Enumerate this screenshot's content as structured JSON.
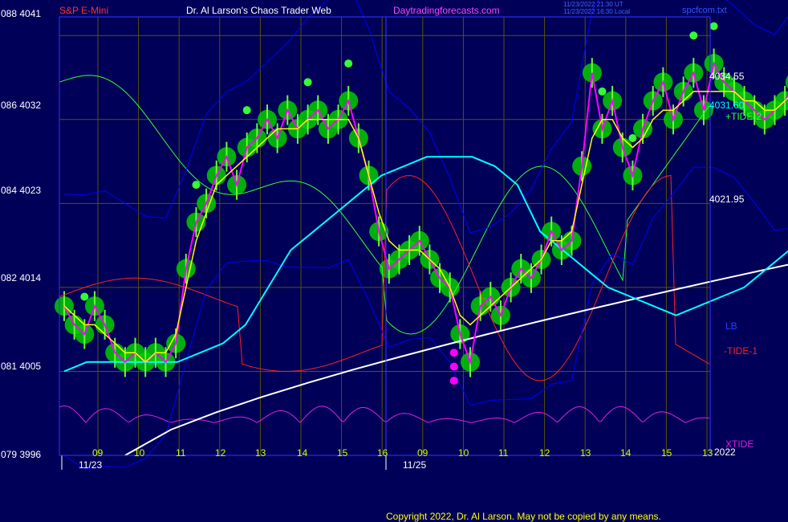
{
  "header": {
    "instrument": "S&P E-Mini",
    "title": "Dr. Al Larson's Chaos Trader Web",
    "site": "Daytradingforecasts.com",
    "timestamp_utc": "11/23/2022 21:30 UT",
    "timestamp_local": "11/23/2022 16:30 Local",
    "file": "spcfcom.txt"
  },
  "footer": {
    "copyright": "Copyright 2022, Dr. Al Larson. May not be copied by any means."
  },
  "colors": {
    "background": "#000058",
    "price": "#ff00ff",
    "price_smooth": "#ffff00",
    "price_avg": "#00ffff",
    "long_avg": "#ffffff",
    "bands": "#0000ff",
    "tide2": "#33ff33",
    "tide1": "#ff2020",
    "xtide": "#dd22dd",
    "glow": "#00cc00",
    "grid": "#555500"
  },
  "chart_data": {
    "type": "line",
    "left_axis_labels": [
      {
        "label": "088 4041",
        "value": 4041
      },
      {
        "label": "086 4032",
        "value": 4032
      },
      {
        "label": "084 4023",
        "value": 4023
      },
      {
        "label": "082 4014",
        "value": 4014
      },
      {
        "label": "081 4005",
        "value": 4005
      },
      {
        "label": "079 3996",
        "value": 3996
      }
    ],
    "right_labels": [
      {
        "text": "4034.55",
        "color": "#ffffff"
      },
      {
        "text": "4031.60",
        "color": "#00ffff"
      },
      {
        "text": "+TIDE-2",
        "color": "#33ff33"
      },
      {
        "text": "4021.95",
        "color": "#ffffff"
      },
      {
        "text": "LB",
        "color": "#0000ff"
      },
      {
        "text": "-TIDE-1",
        "color": "#ff2020"
      },
      {
        "text": "XTIDE",
        "color": "#dd22dd"
      },
      {
        "text": "2022",
        "color": "#ffffff"
      }
    ],
    "x_hours": [
      "09",
      "10",
      "11",
      "12",
      "13",
      "14",
      "15",
      "16",
      "09",
      "10",
      "11",
      "12",
      "13",
      "14",
      "15",
      "13"
    ],
    "x_dates": [
      "11/23",
      "11/25"
    ],
    "ylim": [
      3996,
      4043
    ],
    "price": {
      "x": [
        0,
        0.25,
        0.5,
        0.75,
        1,
        1.25,
        1.5,
        1.75,
        2,
        2.25,
        2.5,
        2.75,
        3,
        3.25,
        3.5,
        3.75,
        4,
        4.25,
        4.5,
        4.75,
        5,
        5.25,
        5.5,
        5.75,
        6,
        6.25,
        6.5,
        6.75,
        7,
        7.25,
        7.5,
        7.75,
        8,
        8.25,
        8.5,
        8.75,
        9,
        9.25,
        9.5,
        9.75,
        10,
        10.25,
        10.5,
        10.75,
        11,
        11.25,
        11.5,
        11.75,
        12,
        12.25,
        12.5,
        12.75,
        13,
        13.25,
        13.5,
        13.75,
        14,
        14.25,
        14.5,
        14.75,
        15,
        15.25,
        15.5,
        15.75,
        16,
        16.25,
        16.5,
        16.75,
        17,
        17.25,
        17.5,
        17.75,
        18,
        18.25,
        18.5,
        18.75,
        19,
        19.25,
        19.5,
        19.75,
        20,
        20.25,
        20.5,
        20.75,
        21,
        21.25,
        21.5,
        21.75,
        22,
        22.25,
        22.5,
        22.75,
        23,
        23.25,
        23.5,
        23.75,
        24
      ],
      "close": [
        4012,
        4010,
        4009,
        4012,
        4010,
        4007,
        4006,
        4007,
        4006,
        4007,
        4006,
        4008,
        4016,
        4021,
        4023,
        4026,
        4028,
        4025,
        4029,
        4030,
        4032,
        4030,
        4033,
        4031,
        4032,
        4033,
        4031,
        4032,
        4034,
        4030,
        4026,
        4020,
        4016,
        4017,
        4018,
        4019,
        4017,
        4015,
        4014,
        4009,
        4006,
        4012,
        4013,
        4011,
        4014,
        4016,
        4015,
        4017,
        4020,
        4018,
        4019,
        4027,
        4037,
        4031,
        4034,
        4029,
        4026,
        4031,
        4034,
        4036,
        4032,
        4035,
        4037,
        4033,
        4038,
        4036,
        4035,
        4034,
        4033,
        4032,
        4033,
        4034,
        4036,
        4035,
        4036,
        4035,
        4034,
        4033,
        4034,
        4033,
        4034,
        4033,
        4032,
        4034,
        4033,
        4034,
        4035,
        4034,
        4033,
        4034,
        4036,
        4035,
        4034,
        4035,
        4036,
        4037,
        4036
      ],
      "smooth": [
        4012,
        4011,
        4010,
        4010,
        4009,
        4008,
        4007,
        4007,
        4006,
        4007,
        4007,
        4009,
        4014,
        4019,
        4022,
        4025,
        4026,
        4027,
        4028,
        4029,
        4030,
        4031,
        4031,
        4031,
        4032,
        4032,
        4032,
        4032,
        4032,
        4030,
        4026,
        4022,
        4019,
        4018,
        4018,
        4018,
        4017,
        4016,
        4014,
        4011,
        4010,
        4011,
        4012,
        4013,
        4014,
        4015,
        4016,
        4017,
        4019,
        4019,
        4020,
        4025,
        4030,
        4032,
        4032,
        4030,
        4029,
        4030,
        4032,
        4033,
        4033,
        4034,
        4035,
        4035,
        4035,
        4035,
        4035,
        4034,
        4034,
        4033,
        4033,
        4034,
        4035,
        4035,
        4035,
        4035,
        4034,
        4034,
        4034,
        4034,
        4034,
        4033,
        4033,
        4033,
        4034,
        4034,
        4034,
        4034,
        4034,
        4034,
        4035,
        4035,
        4035,
        4035,
        4036,
        4036,
        4036
      ],
      "avg": [
        4005,
        4006,
        4006,
        4006,
        4006,
        4006,
        4007,
        4008,
        4010,
        4014,
        4018,
        4020,
        4022,
        4024,
        4026,
        4027,
        4028,
        4028,
        4028,
        4027,
        4025,
        4020,
        4018,
        4016,
        4014,
        4013,
        4012,
        4011,
        4012,
        4013,
        4014,
        4016,
        4018,
        4022,
        4024,
        4025,
        4026,
        4027,
        4028,
        4029,
        4030,
        4031,
        4031,
        4032
      ]
    },
    "long_avg": {
      "x": [
        1.5,
        24
      ],
      "y": [
        3996,
        4022
      ]
    },
    "markers": {
      "green_dots": 10,
      "magenta_dots": 3
    },
    "series": [
      {
        "name": "+TIDE-2",
        "color": "#33ff33"
      },
      {
        "name": "-TIDE-1",
        "color": "#ff2020"
      },
      {
        "name": "XTIDE",
        "color": "#dd22dd"
      }
    ]
  }
}
